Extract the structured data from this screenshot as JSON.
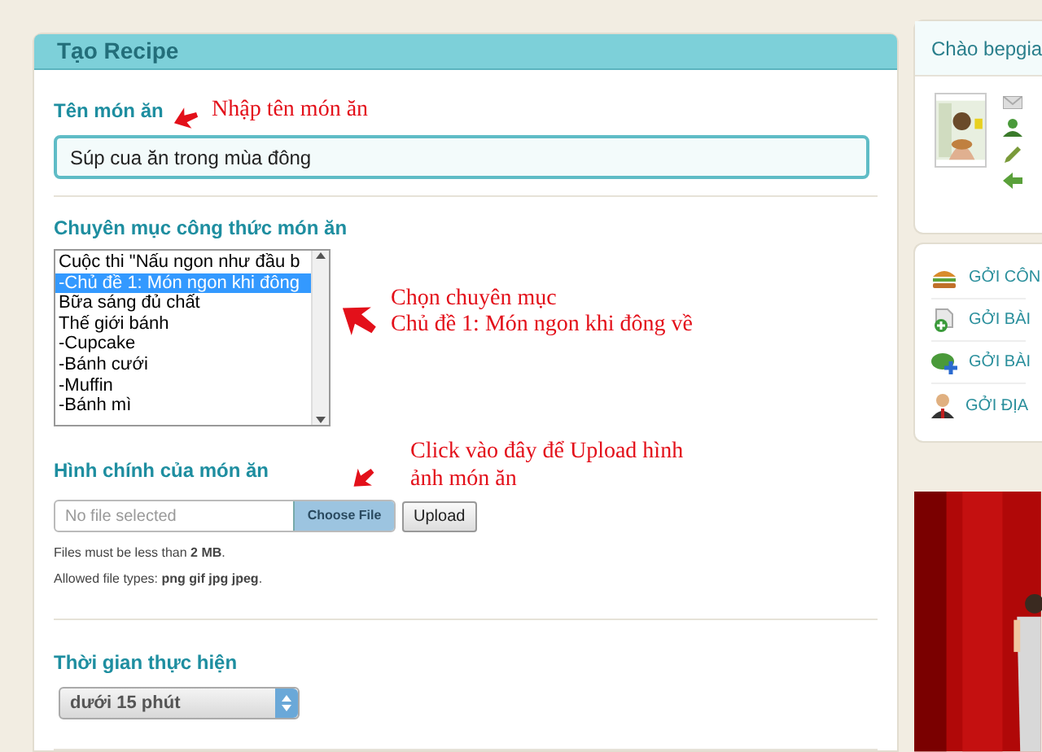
{
  "main": {
    "title": "Tạo Recipe",
    "name_field": {
      "label": "Tên món ăn",
      "value": "Súp cua ăn trong mùa đông"
    },
    "category": {
      "label": "Chuyên mục công thức món ăn",
      "options": [
        {
          "text": "Cuộc thi \"Nấu ngon như đầu b",
          "selected": false
        },
        {
          "text": "-Chủ đề 1: Món ngon khi đông",
          "selected": true
        },
        {
          "text": "Bữa sáng đủ chất",
          "selected": false
        },
        {
          "text": "Thế giới bánh",
          "selected": false
        },
        {
          "text": "-Cupcake",
          "selected": false
        },
        {
          "text": "-Bánh cưới",
          "selected": false
        },
        {
          "text": "-Muffin",
          "selected": false
        },
        {
          "text": "-Bánh mì",
          "selected": false
        }
      ]
    },
    "image": {
      "label": "Hình chính của món ăn",
      "file_placeholder": "No file selected",
      "choose_button": "Choose File",
      "upload_button": "Upload",
      "help": [
        "Files must be less than **2 MB**.",
        "Allowed file types: **png gif jpg jpeg**."
      ]
    },
    "time": {
      "label": "Thời gian thực hiện",
      "value": "dưới 15 phút"
    }
  },
  "annotations": [
    {
      "lines": [
        "Nhập tên món ăn"
      ]
    },
    {
      "lines": [
        "Chọn chuyên mục",
        "Chủ đề 1: Món ngon khi đông về"
      ]
    },
    {
      "lines": [
        "Click vào đây để Upload hình",
        "ảnh món ăn"
      ]
    }
  ],
  "sidebar": {
    "greeting": "Chào bepgia",
    "menu": [
      {
        "label": "GỞI CÔN",
        "kind": "burger"
      },
      {
        "label": "GỞI BÀI",
        "kind": "add"
      },
      {
        "label": "GỞI BÀI",
        "kind": "chat"
      },
      {
        "label": "GỞI ĐỊA",
        "kind": "person"
      }
    ]
  }
}
